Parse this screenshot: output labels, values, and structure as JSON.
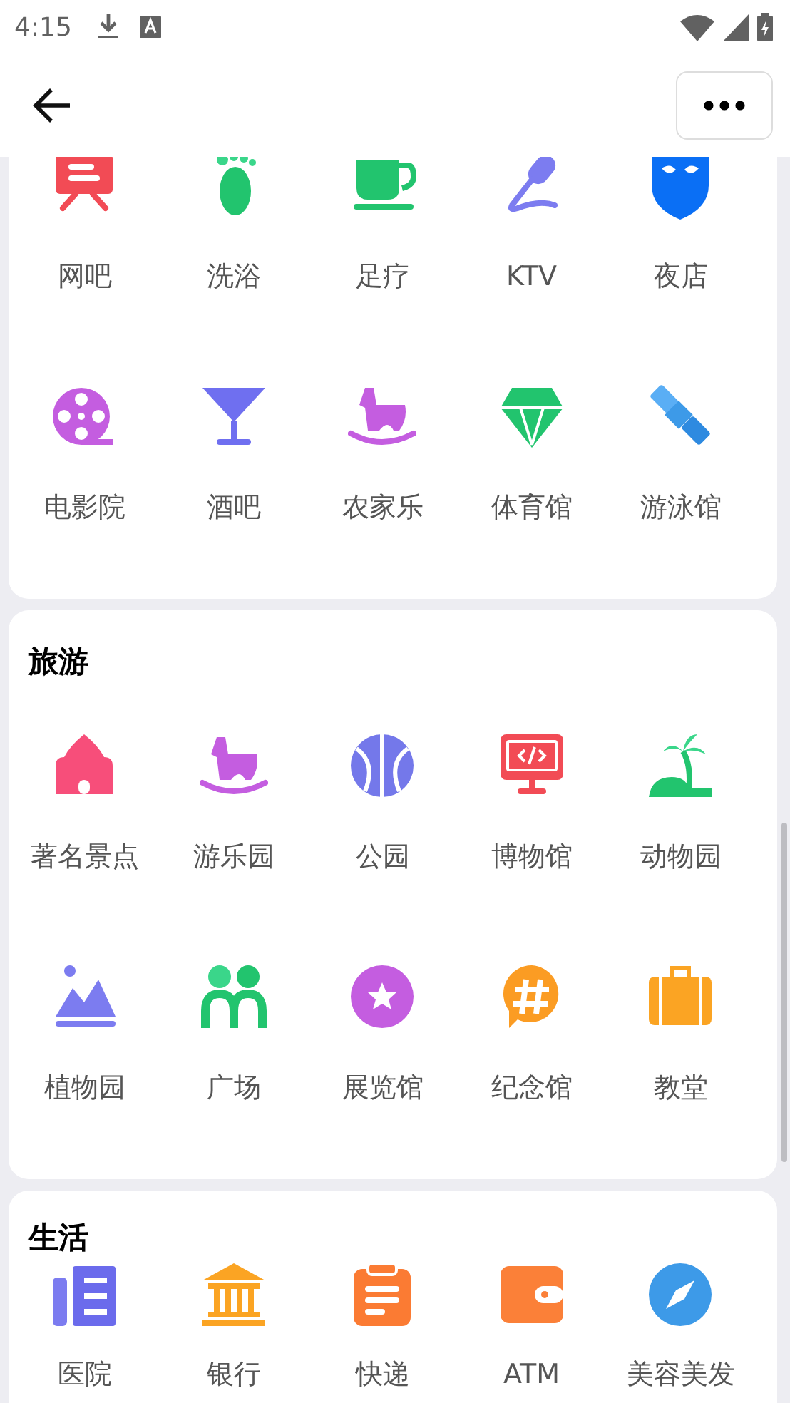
{
  "status_bar": {
    "time": "4:15"
  },
  "sections": [
    {
      "items": [
        "网吧",
        "洗浴",
        "足疗",
        "KTV",
        "夜店",
        "电影院",
        "酒吧",
        "农家乐",
        "体育馆",
        "游泳馆"
      ]
    },
    {
      "title": "旅游",
      "items": [
        "著名景点",
        "游乐园",
        "公园",
        "博物馆",
        "动物园",
        "植物园",
        "广场",
        "展览馆",
        "纪念馆",
        "教堂"
      ]
    },
    {
      "title": "生活",
      "items": [
        "医院",
        "银行",
        "快递",
        "ATM",
        "美容美发"
      ]
    }
  ]
}
